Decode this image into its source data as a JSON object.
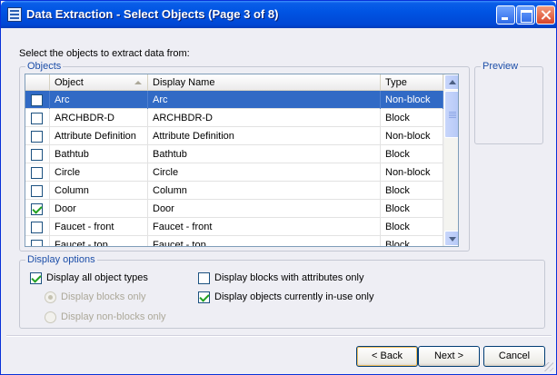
{
  "window": {
    "title": "Data Extraction - Select Objects (Page 3 of 8)",
    "icon": "data-extraction-icon"
  },
  "instruction": "Select the objects to extract data from:",
  "objects_group": {
    "legend": "Objects",
    "columns": [
      "Object",
      "Display Name",
      "Type"
    ],
    "sort_column": "Object",
    "sort_direction": "ascending",
    "rows": [
      {
        "object": "Arc",
        "display_name": "Arc",
        "type": "Non-block",
        "checked": false,
        "selected": true
      },
      {
        "object": "ARCHBDR-D",
        "display_name": "ARCHBDR-D",
        "type": "Block",
        "checked": false,
        "selected": false
      },
      {
        "object": "Attribute Definition",
        "display_name": "Attribute Definition",
        "type": "Non-block",
        "checked": false,
        "selected": false
      },
      {
        "object": "Bathtub",
        "display_name": "Bathtub",
        "type": "Block",
        "checked": false,
        "selected": false
      },
      {
        "object": "Circle",
        "display_name": "Circle",
        "type": "Non-block",
        "checked": false,
        "selected": false
      },
      {
        "object": "Column",
        "display_name": "Column",
        "type": "Block",
        "checked": false,
        "selected": false
      },
      {
        "object": "Door",
        "display_name": "Door",
        "type": "Block",
        "checked": true,
        "selected": false
      },
      {
        "object": "Faucet - front",
        "display_name": "Faucet - front",
        "type": "Block",
        "checked": false,
        "selected": false
      },
      {
        "object": "Faucet - top",
        "display_name": "Faucet - top",
        "type": "Block",
        "checked": false,
        "selected": false
      }
    ]
  },
  "preview_group": {
    "legend": "Preview"
  },
  "display_options": {
    "legend": "Display options",
    "display_all_object_types": {
      "label": "Display all object types",
      "checked": true
    },
    "display_blocks_only": {
      "label": "Display blocks only",
      "checked": true,
      "enabled": false
    },
    "display_non_blocks_only": {
      "label": "Display non-blocks only",
      "checked": false,
      "enabled": false
    },
    "display_blocks_with_attributes_only": {
      "label": "Display blocks with attributes only",
      "checked": false
    },
    "display_objects_in_use_only": {
      "label": "Display objects currently in-use only",
      "checked": true
    }
  },
  "buttons": {
    "back": "< Back",
    "next": "Next >",
    "cancel": "Cancel"
  }
}
